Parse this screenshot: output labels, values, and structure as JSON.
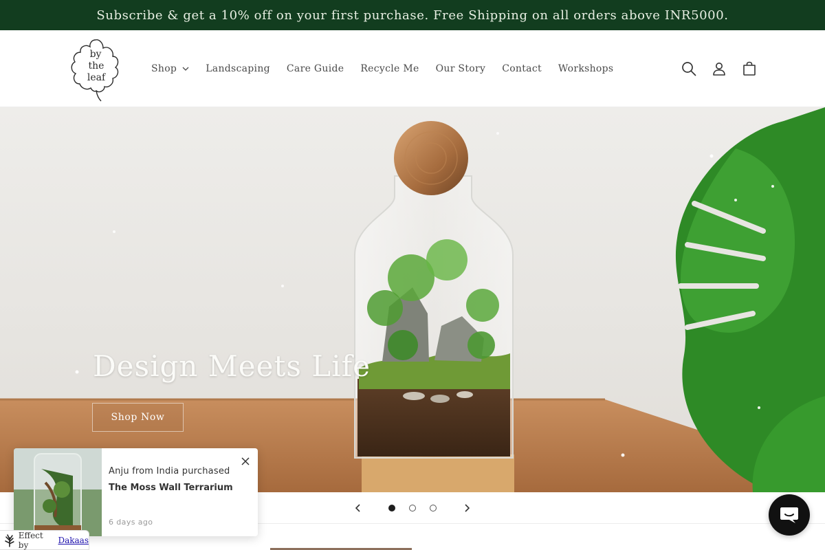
{
  "announcement": {
    "text": "Subscribe & get a 10% off on your first purchase. Free Shipping on all orders above INR5000."
  },
  "header": {
    "logo_lines": [
      "by",
      "the",
      "leaf"
    ],
    "nav": [
      {
        "label": "Shop",
        "has_dropdown": true
      },
      {
        "label": "Landscaping"
      },
      {
        "label": "Care Guide"
      },
      {
        "label": "Recycle Me"
      },
      {
        "label": "Our Story"
      },
      {
        "label": "Contact"
      },
      {
        "label": "Workshops"
      }
    ],
    "icons": [
      "search-icon",
      "account-icon",
      "cart-icon"
    ]
  },
  "hero": {
    "title": "Design Meets Life",
    "button_label": "Shop Now"
  },
  "slider": {
    "slide_count": 3,
    "active_index": 0
  },
  "popup": {
    "line1": "Anju from India purchased",
    "product": "The Moss Wall Terrarium",
    "time": "6 days ago"
  },
  "credit": {
    "prefix": "Effect by",
    "link": "Dakaas"
  },
  "colors": {
    "announcement_bg": "#123d1f",
    "text": "#4a4a4a",
    "chat_bg": "#111111"
  }
}
